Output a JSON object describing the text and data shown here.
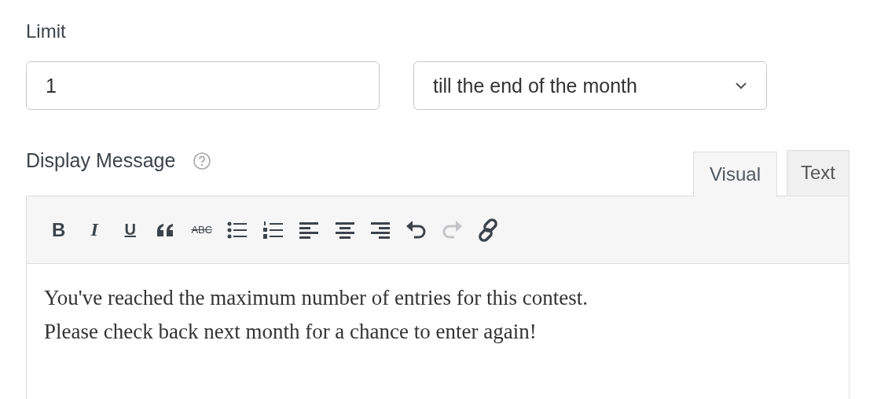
{
  "limit": {
    "label": "Limit",
    "value": "1",
    "period": "till the end of the month"
  },
  "message": {
    "label": "Display Message",
    "tabs": [
      {
        "label": "Visual",
        "selected": true
      },
      {
        "label": "Text",
        "selected": false
      }
    ],
    "toolbar": [
      {
        "kind": "bold",
        "label": "B",
        "disabled": false
      },
      {
        "kind": "italic",
        "label": "I",
        "disabled": false
      },
      {
        "kind": "underline",
        "label": "U",
        "disabled": false
      },
      {
        "kind": "quote",
        "disabled": false
      },
      {
        "kind": "strike",
        "label": "ABC",
        "disabled": false
      },
      {
        "kind": "bullets",
        "disabled": false
      },
      {
        "kind": "numbers",
        "disabled": false
      },
      {
        "kind": "align-left",
        "disabled": false
      },
      {
        "kind": "align-center",
        "disabled": false
      },
      {
        "kind": "align-right",
        "disabled": false
      },
      {
        "kind": "undo",
        "disabled": false
      },
      {
        "kind": "redo",
        "disabled": true
      },
      {
        "kind": "link",
        "disabled": false
      }
    ],
    "lines": [
      "You've reached the maximum number of entries for this contest.",
      "Please check back next month for a chance to enter again!"
    ]
  }
}
